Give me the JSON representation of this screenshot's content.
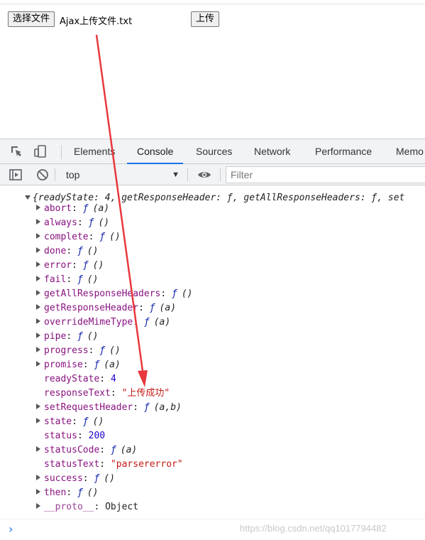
{
  "page": {
    "choose_file_label": "选择文件",
    "file_name": "Ajax上传文件.txt",
    "upload_label": "上传"
  },
  "devtools": {
    "tabs": [
      "Elements",
      "Console",
      "Sources",
      "Network",
      "Performance",
      "Memo"
    ],
    "active_tab": "Console",
    "context": "top",
    "filter_placeholder": "Filter",
    "accent_color": "#1a73e8",
    "icons": [
      "inspect-element-icon",
      "device-toggle-icon",
      "sidebar-toggle-icon",
      "clear-console-icon",
      "eye-icon",
      "chevron-down-icon",
      "prompt-chevron-icon"
    ]
  },
  "console": {
    "summary": "{readyState: 4, getResponseHeader: ƒ, getAllResponseHeaders: ƒ, set",
    "props": [
      {
        "key": "abort",
        "type": "fn",
        "val": "ƒ",
        "args": "(a)",
        "expandable": true
      },
      {
        "key": "always",
        "type": "fn",
        "val": "ƒ",
        "args": "()",
        "expandable": true
      },
      {
        "key": "complete",
        "type": "fn",
        "val": "ƒ",
        "args": "()",
        "expandable": true
      },
      {
        "key": "done",
        "type": "fn",
        "val": "ƒ",
        "args": "()",
        "expandable": true
      },
      {
        "key": "error",
        "type": "fn",
        "val": "ƒ",
        "args": "()",
        "expandable": true
      },
      {
        "key": "fail",
        "type": "fn",
        "val": "ƒ",
        "args": "()",
        "expandable": true
      },
      {
        "key": "getAllResponseHeaders",
        "type": "fn",
        "val": "ƒ",
        "args": "()",
        "expandable": true
      },
      {
        "key": "getResponseHeader",
        "type": "fn",
        "val": "ƒ",
        "args": "(a)",
        "expandable": true
      },
      {
        "key": "overrideMimeType",
        "type": "fn",
        "val": "ƒ",
        "args": "(a)",
        "expandable": true
      },
      {
        "key": "pipe",
        "type": "fn",
        "val": "ƒ",
        "args": "()",
        "expandable": true
      },
      {
        "key": "progress",
        "type": "fn",
        "val": "ƒ",
        "args": "()",
        "expandable": true
      },
      {
        "key": "promise",
        "type": "fn",
        "val": "ƒ",
        "args": "(a)",
        "expandable": true
      },
      {
        "key": "readyState",
        "type": "num",
        "val": "4",
        "args": "",
        "expandable": false
      },
      {
        "key": "responseText",
        "type": "str",
        "val": "\"上传成功\"",
        "args": "",
        "expandable": false
      },
      {
        "key": "setRequestHeader",
        "type": "fn",
        "val": "ƒ",
        "args": "(a,b)",
        "expandable": true
      },
      {
        "key": "state",
        "type": "fn",
        "val": "ƒ",
        "args": "()",
        "expandable": true
      },
      {
        "key": "status",
        "type": "num",
        "val": "200",
        "args": "",
        "expandable": false
      },
      {
        "key": "statusCode",
        "type": "fn",
        "val": "ƒ",
        "args": "(a)",
        "expandable": true
      },
      {
        "key": "statusText",
        "type": "str",
        "val": "\"parsererror\"",
        "args": "",
        "expandable": false
      },
      {
        "key": "success",
        "type": "fn",
        "val": "ƒ",
        "args": "()",
        "expandable": true
      },
      {
        "key": "then",
        "type": "fn",
        "val": "ƒ",
        "args": "()",
        "expandable": true
      },
      {
        "key": "__proto__",
        "type": "obj",
        "val": "Object",
        "args": "",
        "expandable": true
      }
    ]
  },
  "watermark": "https://blog.csdn.net/qq1017794482",
  "annotation_arrow_color": "#e8383d"
}
